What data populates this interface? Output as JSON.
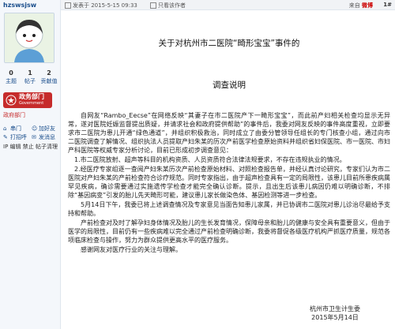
{
  "sidebar": {
    "username": "hzswsjsw",
    "stats": [
      {
        "num": "0",
        "label": "主题"
      },
      {
        "num": "1",
        "label": "帖子"
      },
      {
        "num": "2",
        "label": "贡献值"
      }
    ],
    "gov_badge": {
      "title": "政务部门",
      "subtitle": "Government"
    },
    "gov_link": "政府部门",
    "actions": [
      {
        "label": "串门",
        "icon": "visit-icon"
      },
      {
        "label": "加好友",
        "icon": "add-friend-icon"
      },
      {
        "label": "打招呼",
        "icon": "greet-icon"
      },
      {
        "label": "发消息",
        "icon": "message-icon"
      }
    ],
    "ip_text": "IP 编辑 禁止 帖子清理"
  },
  "topbar": {
    "posted": "发表于 2015-5-15 09:33",
    "only_author": "只看该作者",
    "from_label": "来自",
    "from_source": "微博",
    "floor": "1#"
  },
  "doc": {
    "title": "关于对杭州市二医院“畸形宝宝”事件的",
    "subtitle": "调查说明",
    "paragraphs": [
      "自网友“Rambo_Eecse”在网络反映“其妻子在市二医院产下一畸形宝宝”，而此前产妇相关检查均显示无异常，遂对医院妊娠监督提出质疑，并请求社会和政府提供帮助”的事件后，我委对网友反映的事件高度重视，立即要求市二医院为患儿开通“绿色通道”，并组织积极救治，同时成立了由委分管领导任组长的专门核查小组，通过向市二医院调查了解情况、组织执法人员提取产妇朱某的历次产前医学检查原始资料并组织省妇保医院、市一医院、市妇产科医院等权威专家分析讨论，目前已形成初步调查意见：",
      "1.市二医院放射、超声等科目的机构资质、人员资质符合法律法规要求，不存在违规执业的情况。",
      "2.经医疗专家组逐一查阅产妇朱某历次产前检查原始材料、对照检查报告单，并经认真讨论研究，专家们认为市二医院对产妇朱某的产前检查符合诊疗规范。同时专家指出，由于超声检查具有一定的局限性，该患儿目前所患疾病属罕见疾病，确诊需要通过实施遗传学检查才能完全确认诊断。提示，且出生后该患儿病因仍难以明确诊断，不排除“基因病变”引发的胎儿先天畸形可能，建议患儿家长做染色体、基因检测等进一步检查。",
      "5月14日下午，我委已将上述调查情况及专家意见当面告知患儿家属，并已协调市二医院对患儿诊治尽最给予支持和帮助。",
      "产前检查对及时了解孕妇身体情况及胎儿的生长发育情况，保障母亲和胎儿的健康与安全具有重要意义，但由于医学的局限性，目前仍有一些疾病难以完全通过产前检查明确诊断，我委将督促各级医疗机构严抓医疗质量，规范各项临床检查与操作，努力为群众提供更高水平的医疗服务。",
      "感谢网友对医疗行业的关注与理解。"
    ],
    "signature": {
      "org": "杭州市卫生计生委",
      "date": "2015年5月14日"
    }
  },
  "colors": {
    "accent": "#1a4e8c",
    "gov_red": "#c62b2b"
  }
}
